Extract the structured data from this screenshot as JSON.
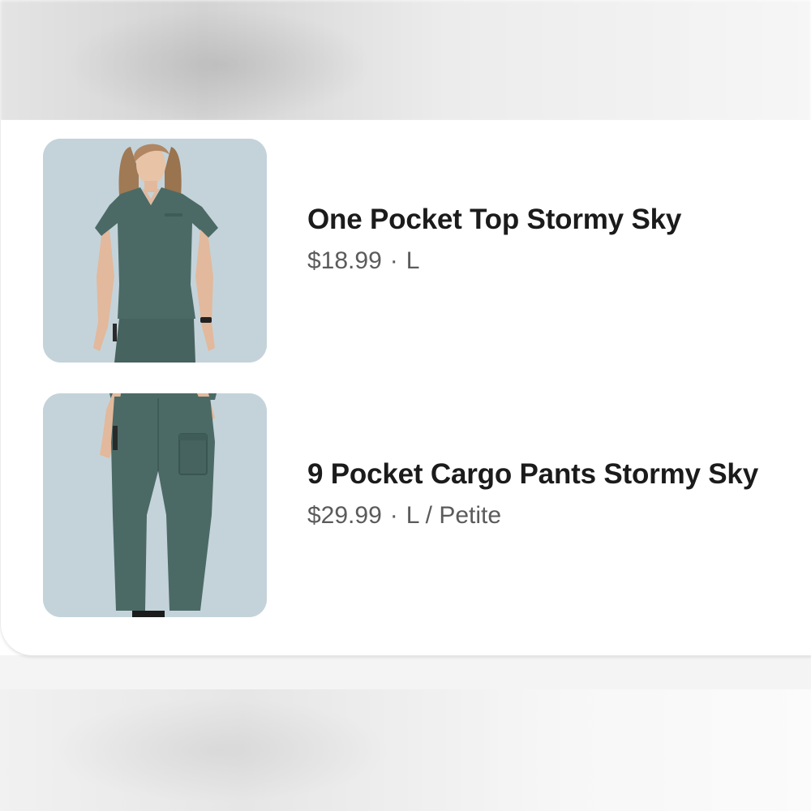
{
  "colors": {
    "thumbnail_background": "#c4d3da",
    "garment": "#4b6a66",
    "title_text": "#1b1b1b",
    "meta_text": "#5b5b5b"
  },
  "items": [
    {
      "title": "One Pocket Top Stormy Sky",
      "price": "$18.99",
      "separator": "·",
      "size": "L",
      "image_icon": "scrub-top-image"
    },
    {
      "title": "9 Pocket Cargo Pants Stormy Sky",
      "price": "$29.99",
      "separator": "·",
      "size": "L / Petite",
      "image_icon": "cargo-pants-image"
    }
  ]
}
